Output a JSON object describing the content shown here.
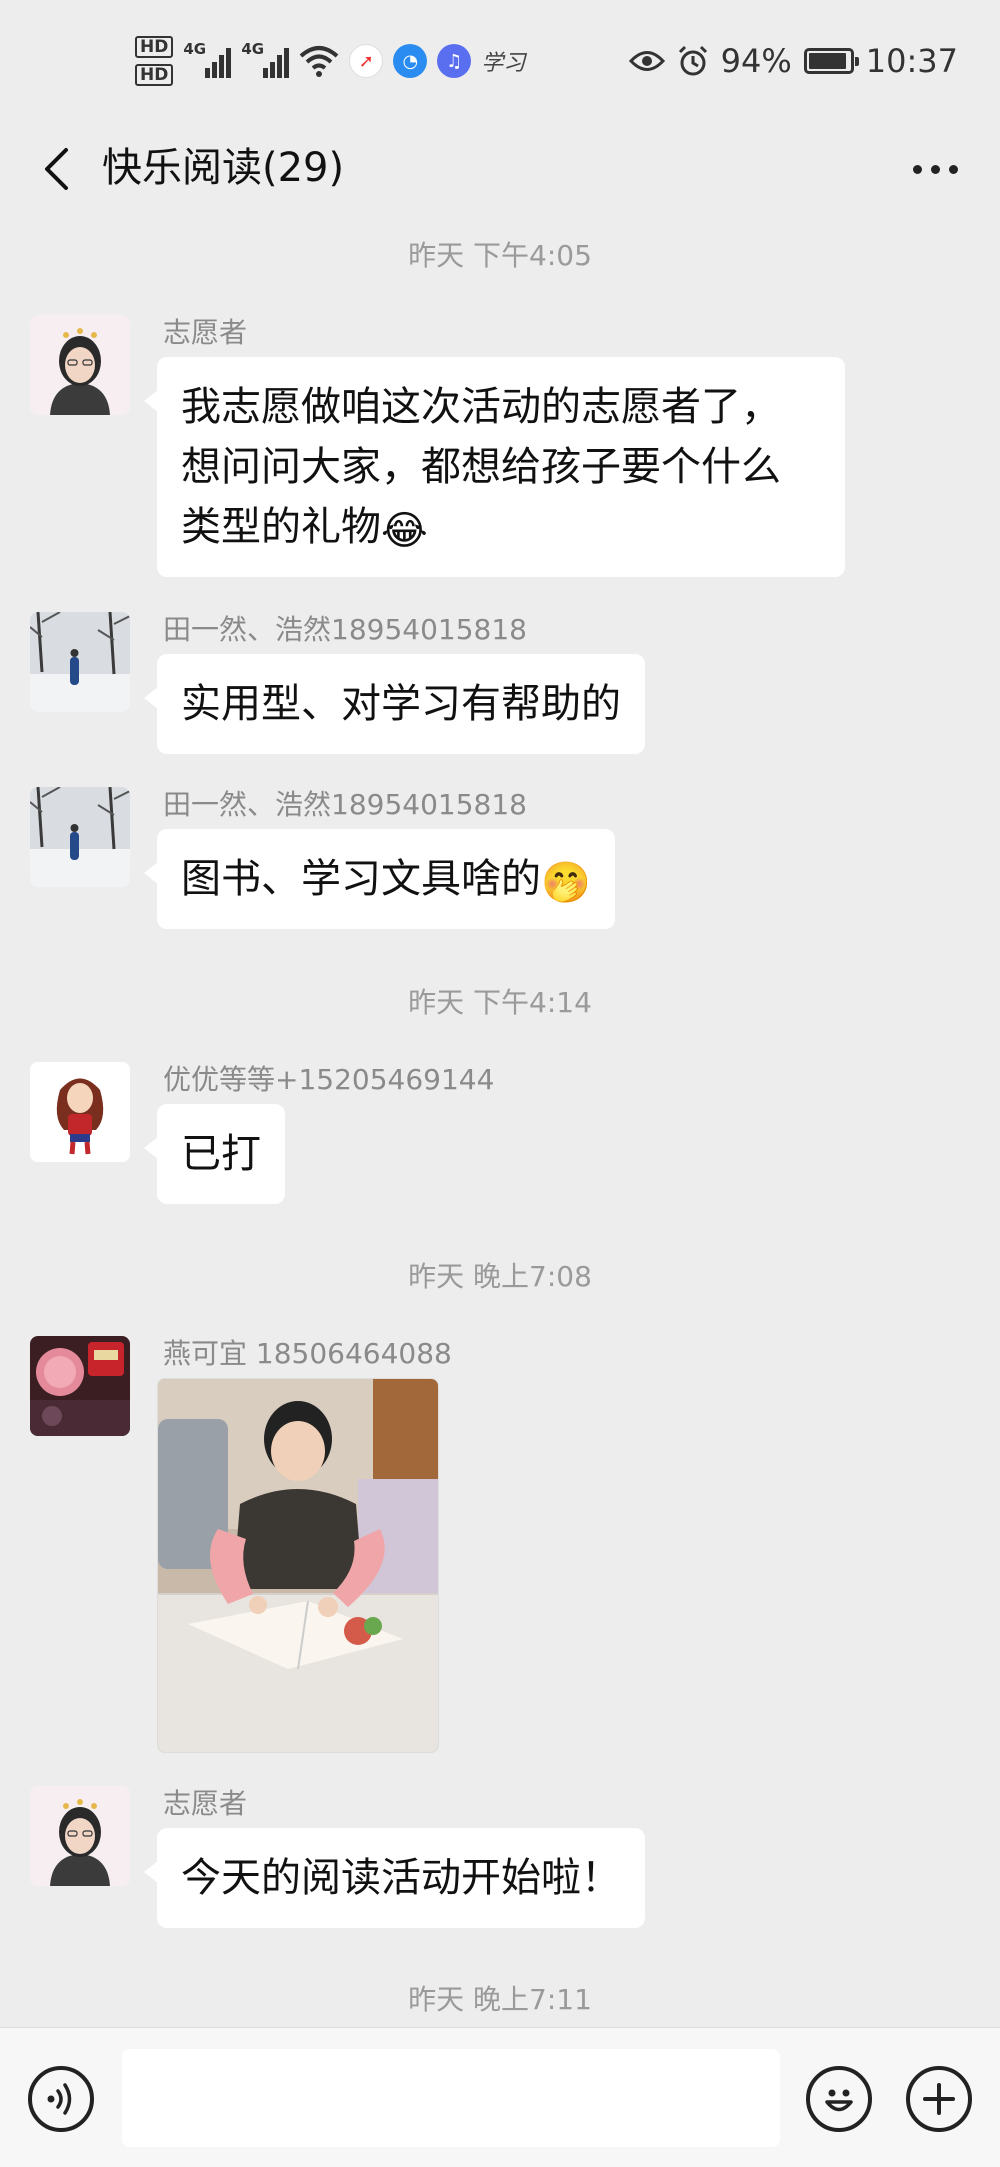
{
  "status_bar": {
    "hd1": "HD",
    "hd2": "HD",
    "net1": "4G",
    "net2": "4G",
    "xuexi_label": "学习",
    "battery_text": "94%",
    "battery_level": 0.94,
    "time": "10:37",
    "icons": [
      "hd-icon",
      "signal-icon",
      "wifi-icon",
      "eye-icon",
      "alarm-icon",
      "battery-icon"
    ]
  },
  "header": {
    "title": "快乐阅读(29)",
    "back_icon": "back-icon",
    "more_icon": "more-icon"
  },
  "messages": {
    "ts1": "昨天 下午4:05",
    "m1": {
      "sender": "志愿者",
      "line1": "我志愿做咱这次活动的志愿者了，",
      "line2": "想问问大家，都想给孩子要个什么",
      "line3": "类型的礼物",
      "emoji": "😂"
    },
    "m2": {
      "sender": "田一然、浩然18954015818",
      "text": "实用型、对学习有帮助的"
    },
    "m3": {
      "sender": "田一然、浩然18954015818",
      "text": "图书、学习文具啥的",
      "emoji": "🤭"
    },
    "ts2": "昨天 下午4:14",
    "m4": {
      "sender": "优优等等+15205469144",
      "text": "已打"
    },
    "ts3": "昨天 晚上7:08",
    "m5": {
      "sender": "燕可宜 18506464088"
    },
    "m6": {
      "sender": "志愿者",
      "text": "今天的阅读活动开始啦！"
    },
    "ts4": "昨天 晚上7:11"
  },
  "input_bar": {
    "voice_icon": "voice-icon",
    "emoji_icon": "emoji-icon",
    "add_icon": "plus-icon"
  }
}
